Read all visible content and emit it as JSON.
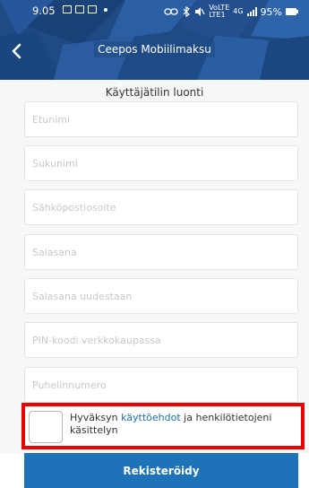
{
  "statusbar": {
    "time": "9.05",
    "network_label_top": "VoLTE",
    "network_label_bottom": "LTE1",
    "signal_label": "4G",
    "battery": "95%"
  },
  "titlebar": {
    "title": "Ceepos Mobiilimaksu",
    "back_icon": "chevron-left-icon"
  },
  "form": {
    "heading": "Käyttäjätilin luonti",
    "fields": [
      {
        "name": "first-name",
        "placeholder": "Etunimi"
      },
      {
        "name": "last-name",
        "placeholder": "Sukunimi"
      },
      {
        "name": "email",
        "placeholder": "Sähköpostiosoite"
      },
      {
        "name": "password",
        "placeholder": "Salasana"
      },
      {
        "name": "password-repeat",
        "placeholder": "Salasana uudestaan"
      },
      {
        "name": "pin",
        "placeholder": "PIN-koodi verkkokaupassa"
      },
      {
        "name": "phone",
        "placeholder": "Puhelinnumero"
      }
    ]
  },
  "consent": {
    "prefix": "Hyväksyn ",
    "link": "käyttöehdot",
    "suffix": " ja henkilötietojeni käsittelyn"
  },
  "register": {
    "label": "Rekisteröidy"
  },
  "colors": {
    "header_bg": "#1f4a84",
    "link": "#1b6dad",
    "button": "#1d72b8",
    "highlight": "#ee0000"
  }
}
